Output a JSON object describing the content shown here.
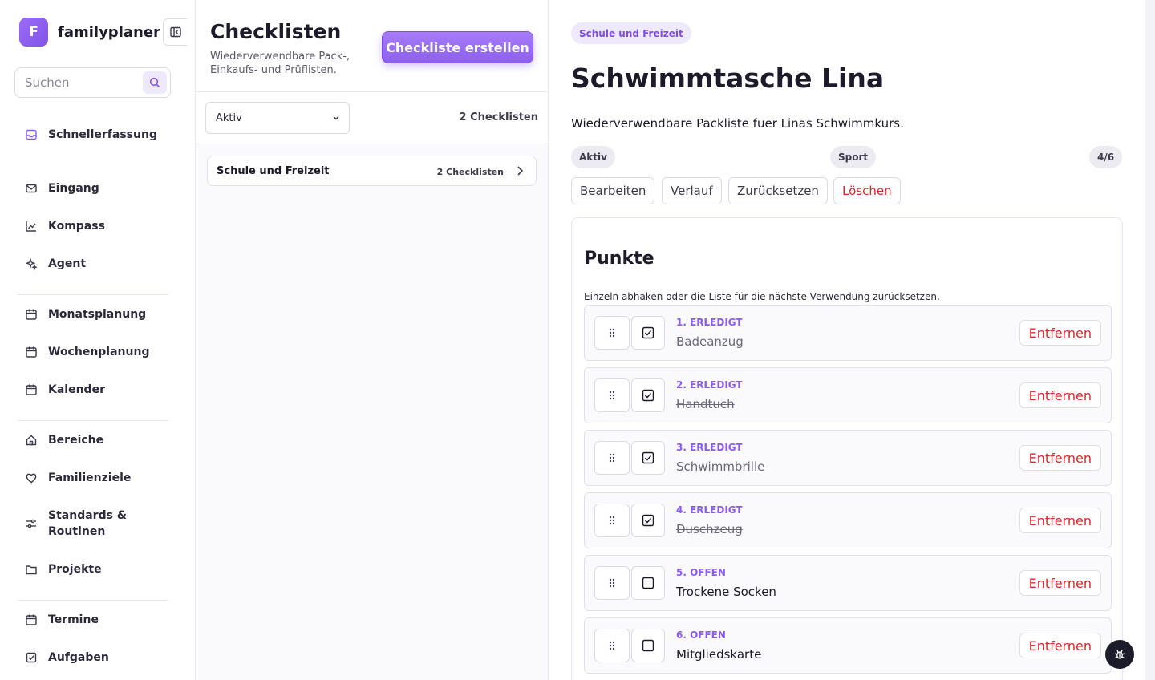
{
  "brand": {
    "logo_letter": "F",
    "name": "familyplaner"
  },
  "search": {
    "placeholder": "Suchen"
  },
  "nav": {
    "schnellerfassung": "Schnellerfassung",
    "eingang": "Eingang",
    "kompass": "Kompass",
    "agent": "Agent",
    "monatsplanung": "Monatsplanung",
    "wochenplanung": "Wochenplanung",
    "kalender": "Kalender",
    "bereiche": "Bereiche",
    "familienziele": "Familienziele",
    "standards_line1": "Standards &",
    "standards_line2": "Routinen",
    "projekte": "Projekte",
    "termine": "Termine",
    "aufgaben": "Aufgaben"
  },
  "checklists": {
    "title": "Checklisten",
    "subtitle": "Wiederverwendbare Pack-, Einkaufs- und Prüflisten.",
    "create_label": "Checkliste erstellen",
    "filter_value": "Aktiv",
    "count_label": "2 Checklisten",
    "group": {
      "name": "Schule und Freizeit",
      "count": "2 Checklisten"
    }
  },
  "detail": {
    "category": "Schule und Freizeit",
    "title": "Schwimmtasche Lina",
    "description": "Wiederverwendbare Packliste fuer Linas Schwimmkurs.",
    "status": "Aktiv",
    "tag": "Sport",
    "progress": "4/6",
    "actions": {
      "edit": "Bearbeiten",
      "history": "Verlauf",
      "reset": "Zurücksetzen",
      "delete": "Löschen"
    },
    "points_title": "Punkte",
    "points_subtitle": "Einzeln abhaken oder die Liste für die nächste Verwendung zurücksetzen.",
    "remove_label": "Entfernen",
    "items": [
      {
        "status": "1. ERLEDIGT",
        "name": "Badeanzug",
        "done": true
      },
      {
        "status": "2. ERLEDIGT",
        "name": "Handtuch",
        "done": true
      },
      {
        "status": "3. ERLEDIGT",
        "name": "Schwimmbrille",
        "done": true
      },
      {
        "status": "4. ERLEDIGT",
        "name": "Duschzeug",
        "done": true
      },
      {
        "status": "5. OFFEN",
        "name": "Trockene Socken",
        "done": false
      },
      {
        "status": "6. OFFEN",
        "name": "Mitgliedskarte",
        "done": false
      }
    ]
  },
  "colors": {
    "accent": "#8b5cf0",
    "danger": "#d42a2a",
    "text": "#1c1b29"
  }
}
